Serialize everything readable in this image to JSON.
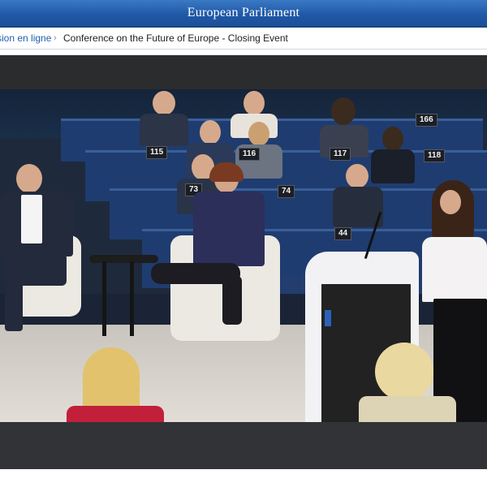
{
  "header": {
    "title": "European Parliament"
  },
  "breadcrumb": {
    "link": "sion en ligne",
    "separator": "›",
    "current": "Conference on the Future of Europe - Closing Event"
  },
  "video": {
    "seat_numbers": [
      "166",
      "115",
      "116",
      "117",
      "118",
      "73",
      "74",
      "44"
    ]
  },
  "colors": {
    "banner": "#2059a8",
    "breadcrumb_link": "#1d5fb0",
    "player_background": "#2b2c2e",
    "desk_blue": "#1f3c70"
  }
}
